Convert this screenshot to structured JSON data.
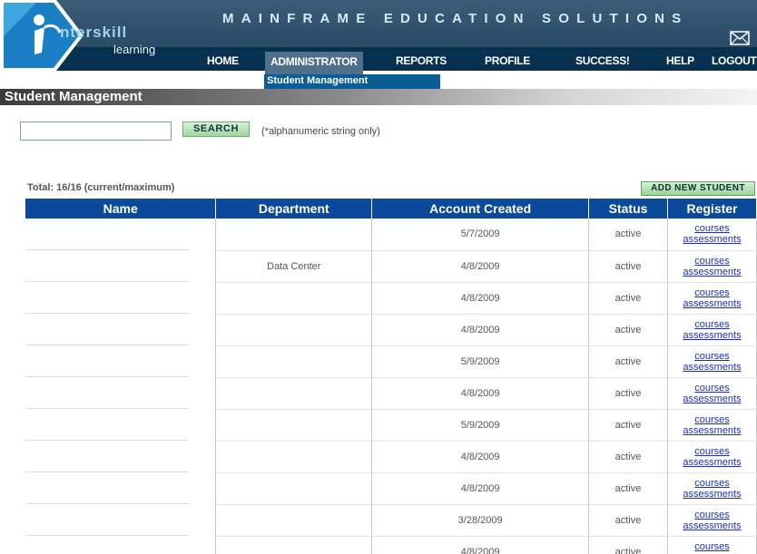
{
  "header": {
    "tagline": "MAINFRAME EDUCATION SOLUTIONS",
    "logo_word": "nterskill",
    "logo_sub": "learning",
    "accent": "#07314f"
  },
  "nav": {
    "items": [
      {
        "label": "HOME"
      },
      {
        "label": "ADMINISTRATOR"
      },
      {
        "label": "REPORTS"
      },
      {
        "label": "PROFILE"
      },
      {
        "label": "SUCCESS!"
      },
      {
        "label": "HELP"
      },
      {
        "label": "LOGOUT"
      }
    ],
    "active_index": 1,
    "submenu_item": "Student Management"
  },
  "page": {
    "title": "Student Management"
  },
  "search": {
    "value": "",
    "button_label": "SEARCH",
    "hint": "(*alphanumeric string only)"
  },
  "table": {
    "total": "Total: 16/16 (current/maximum)",
    "add_button": "ADD NEW STUDENT",
    "columns": [
      "Name",
      "Department",
      "Account Created",
      "Status",
      "Register"
    ],
    "link_courses": "courses",
    "link_assessments": "assessments",
    "rows": [
      {
        "name": "",
        "department": "",
        "created": "5/7/2009",
        "status": "active"
      },
      {
        "name": "",
        "department": "Data Center",
        "created": "4/8/2009",
        "status": "active"
      },
      {
        "name": "",
        "department": "",
        "created": "4/8/2009",
        "status": "active"
      },
      {
        "name": "",
        "department": "",
        "created": "4/8/2009",
        "status": "active"
      },
      {
        "name": "",
        "department": "",
        "created": "5/9/2009",
        "status": "active"
      },
      {
        "name": "",
        "department": "",
        "created": "4/8/2009",
        "status": "active"
      },
      {
        "name": "",
        "department": "",
        "created": "5/9/2009",
        "status": "active"
      },
      {
        "name": "",
        "department": "",
        "created": "4/8/2009",
        "status": "active"
      },
      {
        "name": "",
        "department": "",
        "created": "4/8/2009",
        "status": "active"
      },
      {
        "name": "",
        "department": "",
        "created": "3/28/2009",
        "status": "active"
      },
      {
        "name": "",
        "department": "",
        "created": "4/8/2009",
        "status": "active"
      }
    ]
  },
  "icons": {
    "mail": "mail-icon",
    "logo": "interskill-logo-icon"
  }
}
